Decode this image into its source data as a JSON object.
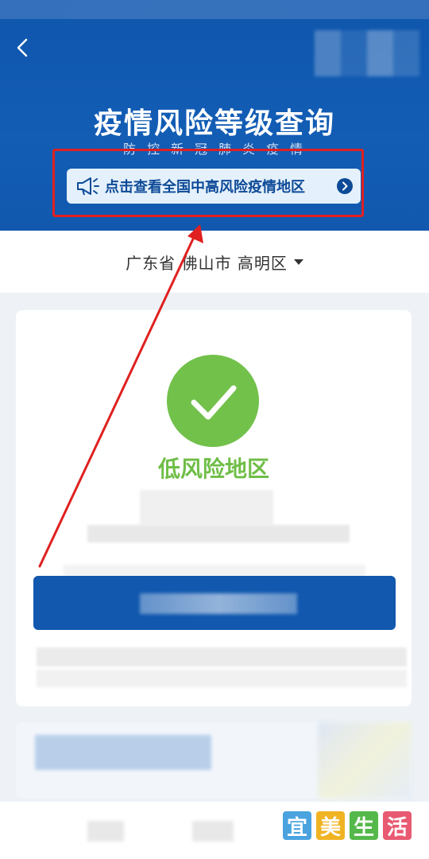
{
  "header": {
    "title": "疫情风险等级查询",
    "subtitle": "防控新冠肺炎疫情",
    "risk_link": "点击查看全国中高风险疫情地区"
  },
  "location": {
    "text": "广东省 佛山市 高明区"
  },
  "result": {
    "status": "低风险地区",
    "status_color": "#72c14b"
  },
  "colors": {
    "brand_blue": "#1158ae",
    "annotation_red": "#e02020"
  },
  "icons": {
    "back": "chevron-left-icon",
    "link": "megaphone-icon",
    "link_arrow": "chevron-right-circle-icon",
    "dropdown": "caret-down-icon",
    "result": "check-circle-icon"
  },
  "watermark": {
    "chars": [
      "宜",
      "美",
      "生",
      "活"
    ],
    "colors": [
      "#4aa3df",
      "#f0b323",
      "#55b84a",
      "#e85a71"
    ]
  }
}
